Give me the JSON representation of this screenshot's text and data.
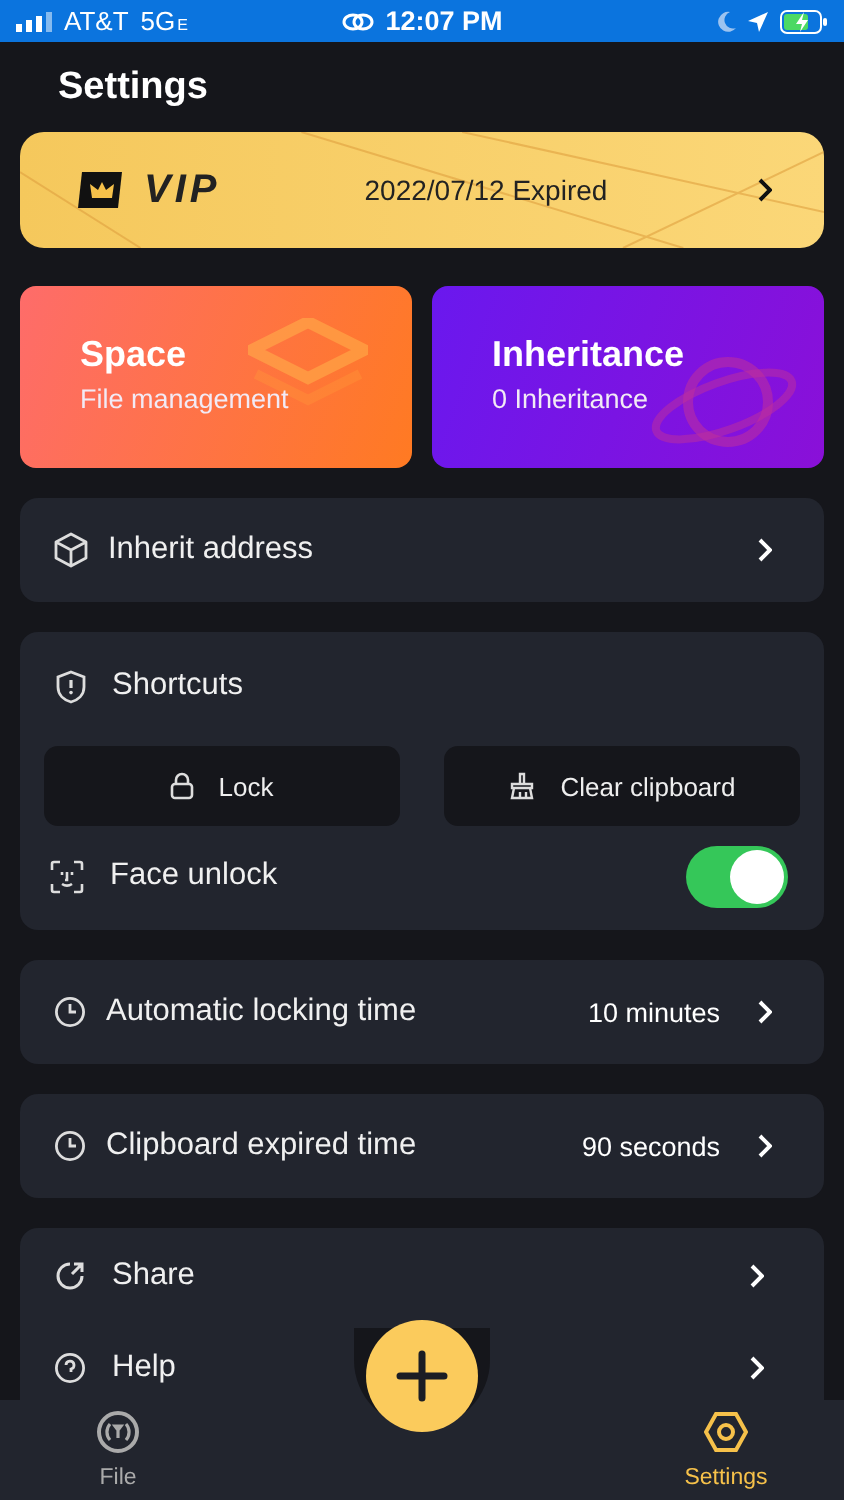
{
  "status_bar": {
    "carrier": "AT&T",
    "network": "5G",
    "network_suffix": "E",
    "time": "12:07 PM"
  },
  "title": "Settings",
  "vip": {
    "label": "VIP",
    "status": "2022/07/12 Expired"
  },
  "cards": [
    {
      "kind": "space",
      "title": "Space",
      "subtitle": "File management"
    },
    {
      "kind": "inheritance",
      "title": "Inheritance",
      "subtitle": "0 Inheritance"
    }
  ],
  "inherit_address": {
    "label": "Inherit address"
  },
  "shortcuts": {
    "title": "Shortcuts",
    "buttons": [
      {
        "kind": "lock",
        "label": "Lock"
      },
      {
        "kind": "clear",
        "label": "Clear clipboard"
      }
    ],
    "face_unlock": {
      "label": "Face unlock",
      "on": true
    }
  },
  "timers": [
    {
      "label": "Automatic locking time",
      "value": "10 minutes"
    },
    {
      "label": "Clipboard expired time",
      "value": "90 seconds"
    }
  ],
  "more": [
    {
      "kind": "share",
      "label": "Share"
    },
    {
      "kind": "help",
      "label": "Help"
    }
  ],
  "tab_bar": [
    {
      "kind": "file",
      "label": "File",
      "selected": false
    },
    {
      "kind": "settings",
      "label": "Settings",
      "selected": true
    }
  ]
}
